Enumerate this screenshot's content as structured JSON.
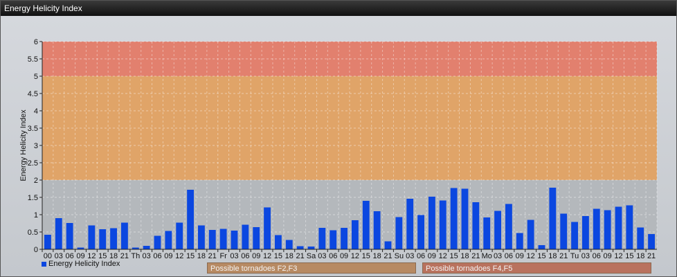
{
  "window": {
    "title": "Energy Helicity Index"
  },
  "legend": {
    "series_label": "Energy Helicity Index"
  },
  "zones": [
    {
      "label": "Possible tornadoes F2,F3",
      "color": "#b78a63"
    },
    {
      "label": "Possible tornadoes F4,F5",
      "color": "#b9725e"
    }
  ],
  "colors": {
    "bar": "#0b47e0",
    "band_mid": "#e0a468",
    "band_high": "#e2806e",
    "plot_bg": "#b4b8bc"
  },
  "chart_data": {
    "type": "bar",
    "ylabel": "Energy Helicity Index",
    "ylim": [
      0,
      6
    ],
    "yticks": [
      0,
      0.5,
      1,
      1.5,
      2,
      2.5,
      3,
      3.5,
      4,
      4.5,
      5,
      5.5,
      6
    ],
    "grid": true,
    "legend_position": "bottom-left",
    "bands": [
      {
        "from": 2,
        "to": 5,
        "label": "Possible tornadoes F2,F3"
      },
      {
        "from": 5,
        "to": 6,
        "label": "Possible tornadoes F4,F5"
      }
    ],
    "categories": [
      "00",
      "03",
      "06",
      "09",
      "12",
      "15",
      "18",
      "21",
      "Th",
      "03",
      "06",
      "09",
      "12",
      "15",
      "18",
      "21",
      "Fr",
      "03",
      "06",
      "09",
      "12",
      "15",
      "18",
      "21",
      "Sa",
      "03",
      "06",
      "09",
      "12",
      "15",
      "18",
      "21",
      "Su",
      "03",
      "06",
      "09",
      "12",
      "15",
      "18",
      "21",
      "Mo",
      "03",
      "06",
      "09",
      "12",
      "15",
      "18",
      "21",
      "Tu",
      "03",
      "06",
      "09",
      "12",
      "15",
      "18",
      "21"
    ],
    "series": [
      {
        "name": "Energy Helicity Index",
        "values": [
          0.42,
          0.9,
          0.76,
          0.05,
          0.69,
          0.58,
          0.61,
          0.77,
          0.05,
          0.1,
          0.39,
          0.53,
          0.77,
          1.72,
          0.69,
          0.56,
          0.59,
          0.54,
          0.71,
          0.64,
          1.21,
          0.41,
          0.27,
          0.09,
          0.08,
          0.62,
          0.55,
          0.62,
          0.84,
          1.4,
          1.1,
          0.23,
          0.93,
          1.46,
          0.99,
          1.52,
          1.41,
          1.77,
          1.75,
          1.36,
          0.92,
          1.11,
          1.31,
          0.47,
          0.85,
          0.12,
          1.78,
          1.03,
          0.79,
          0.96,
          1.17,
          1.13,
          1.23,
          1.27,
          0.63,
          0.44
        ]
      }
    ]
  }
}
